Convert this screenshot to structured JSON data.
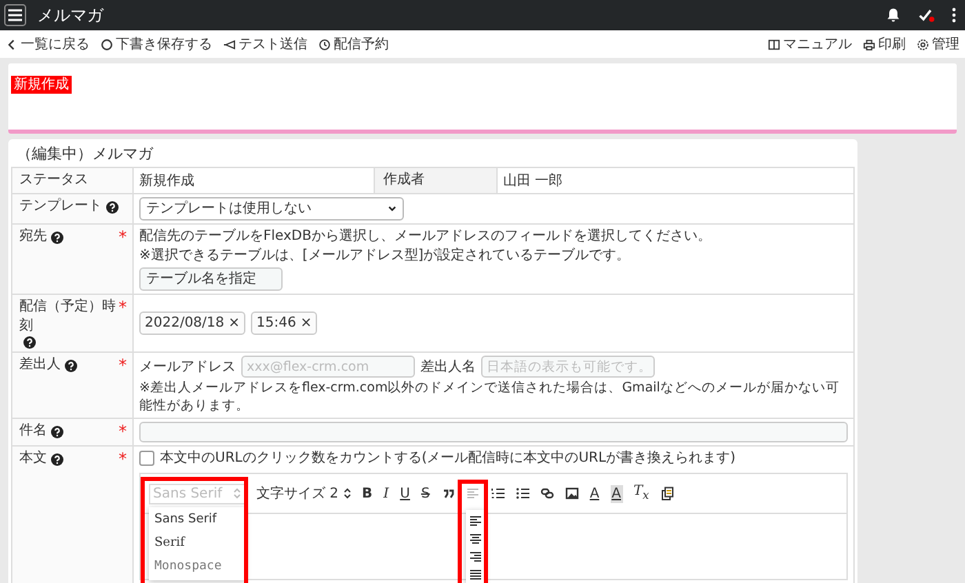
{
  "app_bar": {
    "title": "メルマガ"
  },
  "toolbar": {
    "left": [
      {
        "label": "一覧に戻る"
      },
      {
        "label": "下書き保存する"
      },
      {
        "label": "テスト送信"
      },
      {
        "label": "配信予約"
      }
    ],
    "right": [
      {
        "label": "マニュアル"
      },
      {
        "label": "印刷"
      },
      {
        "label": "管理"
      }
    ]
  },
  "notice": {
    "badge": "新規作成"
  },
  "form": {
    "title": "（編集中）メルマガ",
    "required_mark": "*",
    "rows": [
      {
        "kind": "status",
        "label": "ステータス",
        "help": false,
        "required": false,
        "value": "新規作成",
        "creator_label": "作成者",
        "creator": "山田 一郎"
      },
      {
        "kind": "select",
        "label": "テンプレート",
        "help": true,
        "required": false,
        "value": "テンプレートは使用しない"
      },
      {
        "kind": "table",
        "label": "宛先",
        "help": true,
        "required": true,
        "notes": [
          "配信先のテーブルをFlexDBから選択し、メールアドレスのフィールドを選択してください。",
          "※選択できるテーブルは、[メールアドレス型]が設定されているテーブルです。"
        ],
        "button": "テーブル名を指定"
      },
      {
        "kind": "datetime",
        "label": "配信（予定）時刻",
        "help": true,
        "required": true,
        "date": "2022/08/18",
        "time": "15:46",
        "clear": "×"
      },
      {
        "kind": "sender",
        "label": "差出人",
        "help": true,
        "required": true,
        "email_label": "メールアドレス",
        "email_placeholder": "xxx@flex-crm.com",
        "name_label": "差出人名",
        "name_placeholder": "日本語の表示も可能です。",
        "note": "※差出人メールアドレスをflex-crm.com以外のドメインで送信された場合は、Gmailなどへのメールが届かない可能性があります。"
      },
      {
        "kind": "text",
        "label": "件名",
        "help": true,
        "required": true
      },
      {
        "kind": "body",
        "label": "本文",
        "help": true,
        "required": true,
        "track_clicks": {
          "checked": false,
          "label": "本文中のURLのクリック数をカウントする(メール配信時に本文中のURLが書き換えられます)"
        },
        "editor": {
          "font_select": "Sans Serif",
          "font_options": [
            {
              "label": "Sans Serif"
            },
            {
              "label": "Serif"
            },
            {
              "label": "Monospace"
            }
          ],
          "size_select": "文字サイズ 2",
          "format_buttons": [
            {
              "kind": "bold",
              "label": "B"
            },
            {
              "kind": "italic",
              "label": "I"
            },
            {
              "kind": "underline",
              "label": "U"
            },
            {
              "kind": "strike",
              "label": "S"
            }
          ],
          "color_buttons": [
            {
              "kind": "text-color",
              "label": "A"
            },
            {
              "kind": "background-color",
              "label": "A"
            }
          ],
          "clear_button": "T$_{x}$"
        }
      }
    ]
  }
}
